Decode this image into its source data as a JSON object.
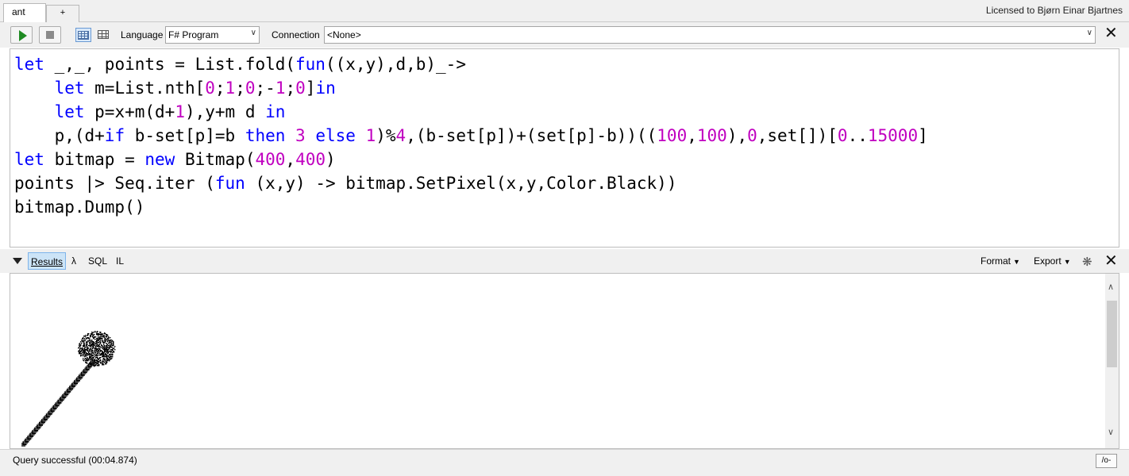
{
  "tabs": [
    {
      "label": "ant"
    },
    {
      "label": "+"
    }
  ],
  "license": "Licensed to Bjørn Einar Bjartnes",
  "toolbar": {
    "language_label": "Language",
    "language_value": "F# Program",
    "connection_label": "Connection",
    "connection_value": "<None>"
  },
  "editor": {
    "lines": [
      [
        {
          "t": "let",
          "c": "kw"
        },
        {
          "t": " _,_, points = List.fold(",
          "c": ""
        },
        {
          "t": "fun",
          "c": "kw"
        },
        {
          "t": "((x,y),d,b)_->",
          "c": ""
        }
      ],
      [
        {
          "t": "    ",
          "c": ""
        },
        {
          "t": "let",
          "c": "kw"
        },
        {
          "t": " m=List.nth[",
          "c": ""
        },
        {
          "t": "0",
          "c": "num"
        },
        {
          "t": ";",
          "c": ""
        },
        {
          "t": "1",
          "c": "num"
        },
        {
          "t": ";",
          "c": ""
        },
        {
          "t": "0",
          "c": "num"
        },
        {
          "t": ";-",
          "c": ""
        },
        {
          "t": "1",
          "c": "num"
        },
        {
          "t": ";",
          "c": ""
        },
        {
          "t": "0",
          "c": "num"
        },
        {
          "t": "]",
          "c": ""
        },
        {
          "t": "in",
          "c": "kw"
        }
      ],
      [
        {
          "t": "    ",
          "c": ""
        },
        {
          "t": "let",
          "c": "kw"
        },
        {
          "t": " p=x+m(d+",
          "c": ""
        },
        {
          "t": "1",
          "c": "num"
        },
        {
          "t": "),y+m d ",
          "c": ""
        },
        {
          "t": "in",
          "c": "kw"
        }
      ],
      [
        {
          "t": "    p,(d+",
          "c": ""
        },
        {
          "t": "if",
          "c": "kw"
        },
        {
          "t": " b-set[p]=b ",
          "c": ""
        },
        {
          "t": "then",
          "c": "kw"
        },
        {
          "t": " ",
          "c": ""
        },
        {
          "t": "3",
          "c": "num"
        },
        {
          "t": " ",
          "c": ""
        },
        {
          "t": "else",
          "c": "kw"
        },
        {
          "t": " ",
          "c": ""
        },
        {
          "t": "1",
          "c": "num"
        },
        {
          "t": ")%",
          "c": ""
        },
        {
          "t": "4",
          "c": "num"
        },
        {
          "t": ",(b-set[p])+(set[p]-b))((",
          "c": ""
        },
        {
          "t": "100",
          "c": "num"
        },
        {
          "t": ",",
          "c": ""
        },
        {
          "t": "100",
          "c": "num"
        },
        {
          "t": "),",
          "c": ""
        },
        {
          "t": "0",
          "c": "num"
        },
        {
          "t": ",set[])[",
          "c": ""
        },
        {
          "t": "0",
          "c": "num"
        },
        {
          "t": "..",
          "c": ""
        },
        {
          "t": "15000",
          "c": "num"
        },
        {
          "t": "]",
          "c": ""
        }
      ],
      [
        {
          "t": "let",
          "c": "kw"
        },
        {
          "t": " bitmap = ",
          "c": ""
        },
        {
          "t": "new",
          "c": "kw"
        },
        {
          "t": " Bitmap(",
          "c": ""
        },
        {
          "t": "400",
          "c": "num"
        },
        {
          "t": ",",
          "c": ""
        },
        {
          "t": "400",
          "c": "num"
        },
        {
          "t": ")",
          "c": ""
        }
      ],
      [
        {
          "t": "points |> Seq.iter (",
          "c": ""
        },
        {
          "t": "fun",
          "c": "kw"
        },
        {
          "t": " (x,y) -> bitmap.SetPixel(x,y,Color.Black))",
          "c": ""
        }
      ],
      [
        {
          "t": "bitmap.Dump()",
          "c": ""
        }
      ]
    ]
  },
  "results_bar": {
    "tabs": [
      {
        "label": "Results"
      },
      {
        "label": "λ"
      },
      {
        "label": "SQL"
      },
      {
        "label": "IL"
      }
    ],
    "format_label": "Format",
    "export_label": "Export"
  },
  "status": {
    "text": "Query successful  (00:04.874)",
    "button_label": "/o-"
  }
}
